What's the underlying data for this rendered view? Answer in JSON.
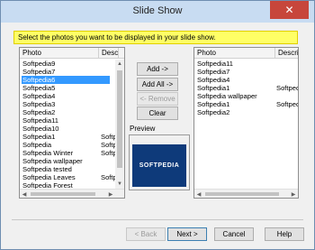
{
  "window": {
    "title": "Slide Show",
    "close_glyph": "✕"
  },
  "instruction": "Select the photos you want to be displayed in your slide show.",
  "left_list": {
    "columns": [
      "Photo",
      "Desc"
    ],
    "rows": [
      {
        "photo": "Softpedia9",
        "desc": ""
      },
      {
        "photo": "Softpedia7",
        "desc": ""
      },
      {
        "photo": "Softpedia6",
        "desc": "",
        "selected": true
      },
      {
        "photo": "Softpedia5",
        "desc": ""
      },
      {
        "photo": "Softpedia4",
        "desc": ""
      },
      {
        "photo": "Softpedia3",
        "desc": ""
      },
      {
        "photo": "Softpedia2",
        "desc": ""
      },
      {
        "photo": "Softpedia11",
        "desc": ""
      },
      {
        "photo": "Softpedia10",
        "desc": ""
      },
      {
        "photo": "Softpedia1",
        "desc": "Softp"
      },
      {
        "photo": "Softpedia",
        "desc": "Softp"
      },
      {
        "photo": "Softpedia Winter",
        "desc": "Softp"
      },
      {
        "photo": "Softpedia wallpaper",
        "desc": ""
      },
      {
        "photo": "Softpedia tested",
        "desc": ""
      },
      {
        "photo": "Softpedia Leaves",
        "desc": "Softp"
      },
      {
        "photo": "Softpedia Forest",
        "desc": ""
      }
    ]
  },
  "right_list": {
    "columns": [
      "Photo",
      "Descripti"
    ],
    "rows": [
      {
        "photo": "Softpedia11",
        "desc": ""
      },
      {
        "photo": "Softpedia7",
        "desc": ""
      },
      {
        "photo": "Softpedia4",
        "desc": ""
      },
      {
        "photo": "Softpedia1",
        "desc": "Softpedi"
      },
      {
        "photo": "Softpedia wallpaper",
        "desc": ""
      },
      {
        "photo": "Softpedia1",
        "desc": "Softpedi"
      },
      {
        "photo": "Softpedia2",
        "desc": ""
      }
    ]
  },
  "buttons": {
    "add": "Add ->",
    "add_all": "Add All ->",
    "remove": "<- Remove",
    "clear": "Clear",
    "back": "< Back",
    "next": "Next >",
    "cancel": "Cancel",
    "help": "Help"
  },
  "preview": {
    "label": "Preview",
    "image_text": "SOFTPEDIA"
  },
  "icons": {
    "up": "▲",
    "down": "▼",
    "left": "◀",
    "right": "▶"
  }
}
